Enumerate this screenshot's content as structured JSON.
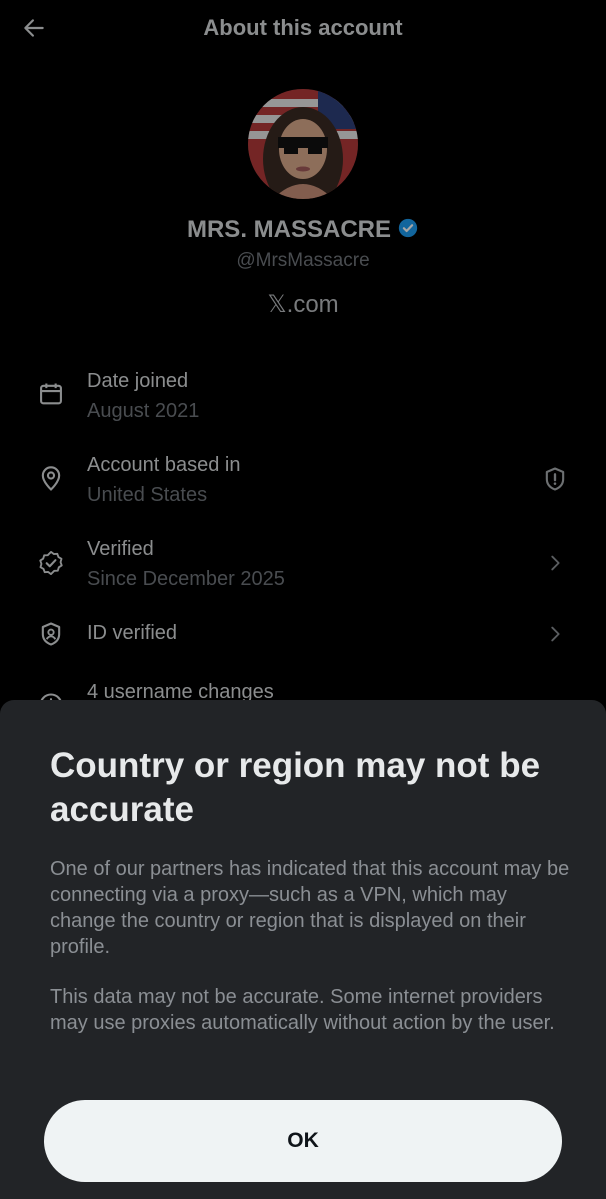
{
  "header": {
    "title": "About this account",
    "back_icon": "arrow-left-icon"
  },
  "profile": {
    "name": "MRS. MASSACRE",
    "handle": "@MrsMassacre",
    "site": "𝕏.com",
    "verified_color": "#1d9bf0"
  },
  "info": {
    "date_joined": {
      "title": "Date joined",
      "value": "August 2021",
      "icon": "calendar-icon"
    },
    "based_in": {
      "title": "Account based in",
      "value": "United States",
      "icon": "location-pin-icon",
      "right_icon": "shield-exclamation-icon"
    },
    "verified": {
      "title": "Verified",
      "value": "Since December 2025",
      "icon": "verified-badge-icon",
      "right_icon": "chevron-right-icon"
    },
    "id_verified": {
      "title": "ID verified",
      "icon": "id-shield-icon",
      "right_icon": "chevron-right-icon"
    },
    "username_changes": {
      "title": "4 username changes",
      "icon": "history-icon"
    }
  },
  "sheet": {
    "title": "Country or region may not be accurate",
    "paragraph1": "One of our partners has indicated that this account may be connecting via a proxy—such as a VPN, which may change the country or region that is displayed on their profile.",
    "paragraph2": "This data may not be accurate. Some internet providers may use proxies automatically without action by the user.",
    "ok_label": "OK"
  },
  "colors": {
    "background": "#000000",
    "sheet": "#222427",
    "button": "#eff3f4"
  }
}
